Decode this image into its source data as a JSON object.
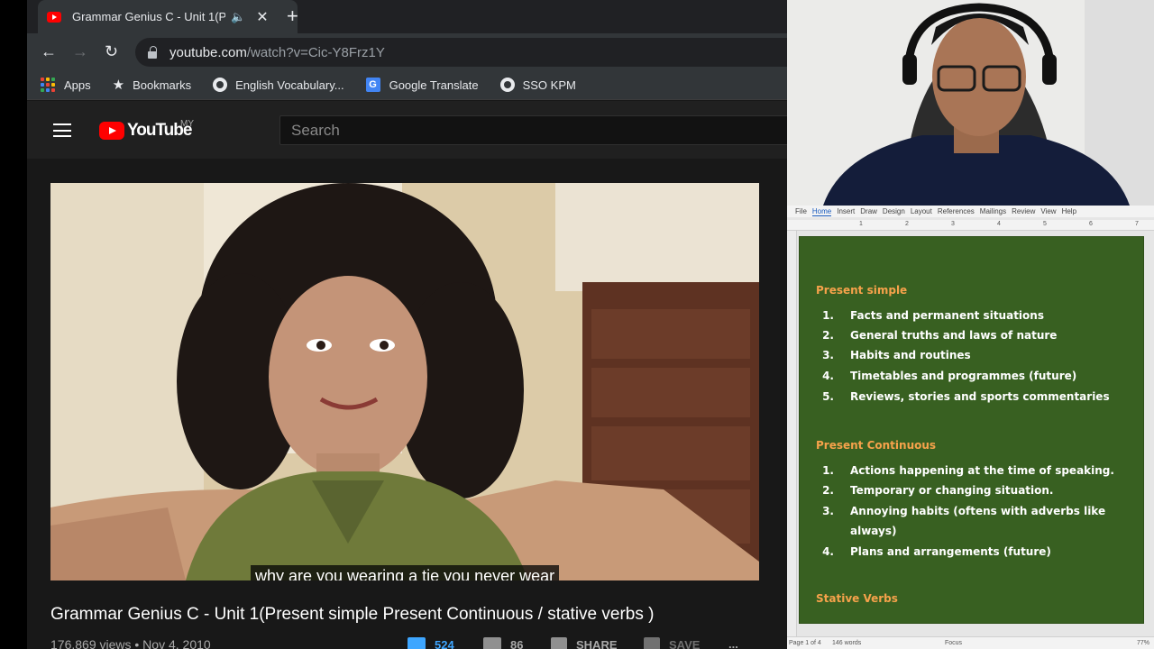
{
  "browser": {
    "tab": {
      "title": "Grammar Genius C - Unit 1(P",
      "audio_icon": "speaker-icon",
      "close_icon": "close-icon"
    },
    "new_tab_icon": "plus-icon",
    "url": {
      "host": "youtube.com",
      "path": "/watch?v=Cic-Y8Frz1Y"
    },
    "bookmarks": [
      {
        "label": "Apps",
        "icon": "apps-grid-icon"
      },
      {
        "label": "Bookmarks",
        "icon": "star-icon"
      },
      {
        "label": "English Vocabulary...",
        "icon": "globe-icon"
      },
      {
        "label": "Google Translate",
        "icon": "google-translate-icon"
      },
      {
        "label": "SSO KPM",
        "icon": "globe-icon"
      }
    ]
  },
  "youtube": {
    "logo_text": "YouTube",
    "country": "MY",
    "search_placeholder": "Search",
    "subtitle": "why are you wearing a tie you never wear",
    "video_title": "Grammar Genius C - Unit 1(Present simple Present Continuous / stative verbs )",
    "views": "176,869 views • Nov 4, 2010",
    "likes": "524",
    "dislikes": "86",
    "share": "SHARE",
    "save": "SAVE",
    "more": "..."
  },
  "word": {
    "ribbon_tabs": [
      "File",
      "Home",
      "Insert",
      "Draw",
      "Design",
      "Layout",
      "References",
      "Mailings",
      "Review",
      "View",
      "Help"
    ],
    "ruler_numbers": [
      "1",
      "2",
      "3",
      "4",
      "5",
      "6",
      "7"
    ],
    "sections": [
      {
        "heading": "Present simple",
        "items": [
          {
            "num": "1.",
            "text": "Facts and permanent situations"
          },
          {
            "num": "2.",
            "text": "General truths and laws of nature"
          },
          {
            "num": "3.",
            "text": "Habits and routines"
          },
          {
            "num": "4.",
            "text": "Timetables and programmes (future)"
          },
          {
            "num": "5.",
            "text": "Reviews, stories and sports commentaries"
          }
        ]
      },
      {
        "heading": "Present Continuous",
        "items": [
          {
            "num": "1.",
            "text": "Actions happening at the time of speaking."
          },
          {
            "num": "2.",
            "text": "Temporary or changing situation."
          },
          {
            "num": "3.",
            "text": "Annoying habits (oftens with adverbs like always)"
          },
          {
            "num": "4.",
            "text": "Plans and arrangements (future)"
          }
        ]
      },
      {
        "heading": "Stative Verbs",
        "items": []
      }
    ],
    "status": {
      "page": "Page 1 of 4",
      "words": "146 words",
      "focus": "Focus",
      "zoom": "77%"
    }
  },
  "colors": {
    "doc_background": "#386021",
    "heading": "#f6a24b",
    "yt_red": "#ff0000",
    "like_blue": "#3ea6ff"
  }
}
